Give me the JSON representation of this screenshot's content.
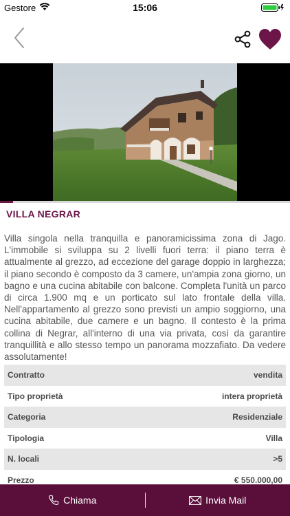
{
  "status_bar": {
    "carrier": "Gestore",
    "time": "15:06"
  },
  "nav": {
    "back_icon": "chevron-left-icon",
    "share_icon": "share-icon",
    "favorite_icon": "heart-icon"
  },
  "gallery": {
    "progress": 0.045
  },
  "listing": {
    "title": "VILLA NEGRAR",
    "description": "Villa singola nella tranquilla e panoramicissima zona di Jago. L'immobile si sviluppa su 2 livelli fuori terra: il piano terra è attualmente al grezzo, ad eccezione del garage doppio in larghezza; il piano secondo è composto da 3 camere, un'ampia zona giorno, un bagno e una cucina abitabile con balcone. Completa l'unità un parco di circa 1.900 mq e un porticato sul lato frontale della villa. Nell'appartamento al grezzo sono previsti un ampio soggiorno, una cucina abitabile, due camere e un bagno. Il contesto è la prima collina di Negrar, all'interno di una via privata, così da garantire tranquillità e allo stesso tempo un panorama mozzafiato. Da vedere assolutamente!"
  },
  "details": [
    {
      "label": "Contratto",
      "value": "vendita"
    },
    {
      "label": "Tipo proprietà",
      "value": "intera proprietà"
    },
    {
      "label": "Categoria",
      "value": "Residenziale"
    },
    {
      "label": "Tipologia",
      "value": "Villa"
    },
    {
      "label": "N. locali",
      "value": ">5"
    },
    {
      "label": "Prezzo",
      "value": "€ 550.000,00"
    }
  ],
  "actions": {
    "call_label": "Chiama",
    "mail_label": "Invia Mail"
  },
  "colors": {
    "brand": "#6b1548",
    "bottom_bar": "#5a0f3b"
  }
}
